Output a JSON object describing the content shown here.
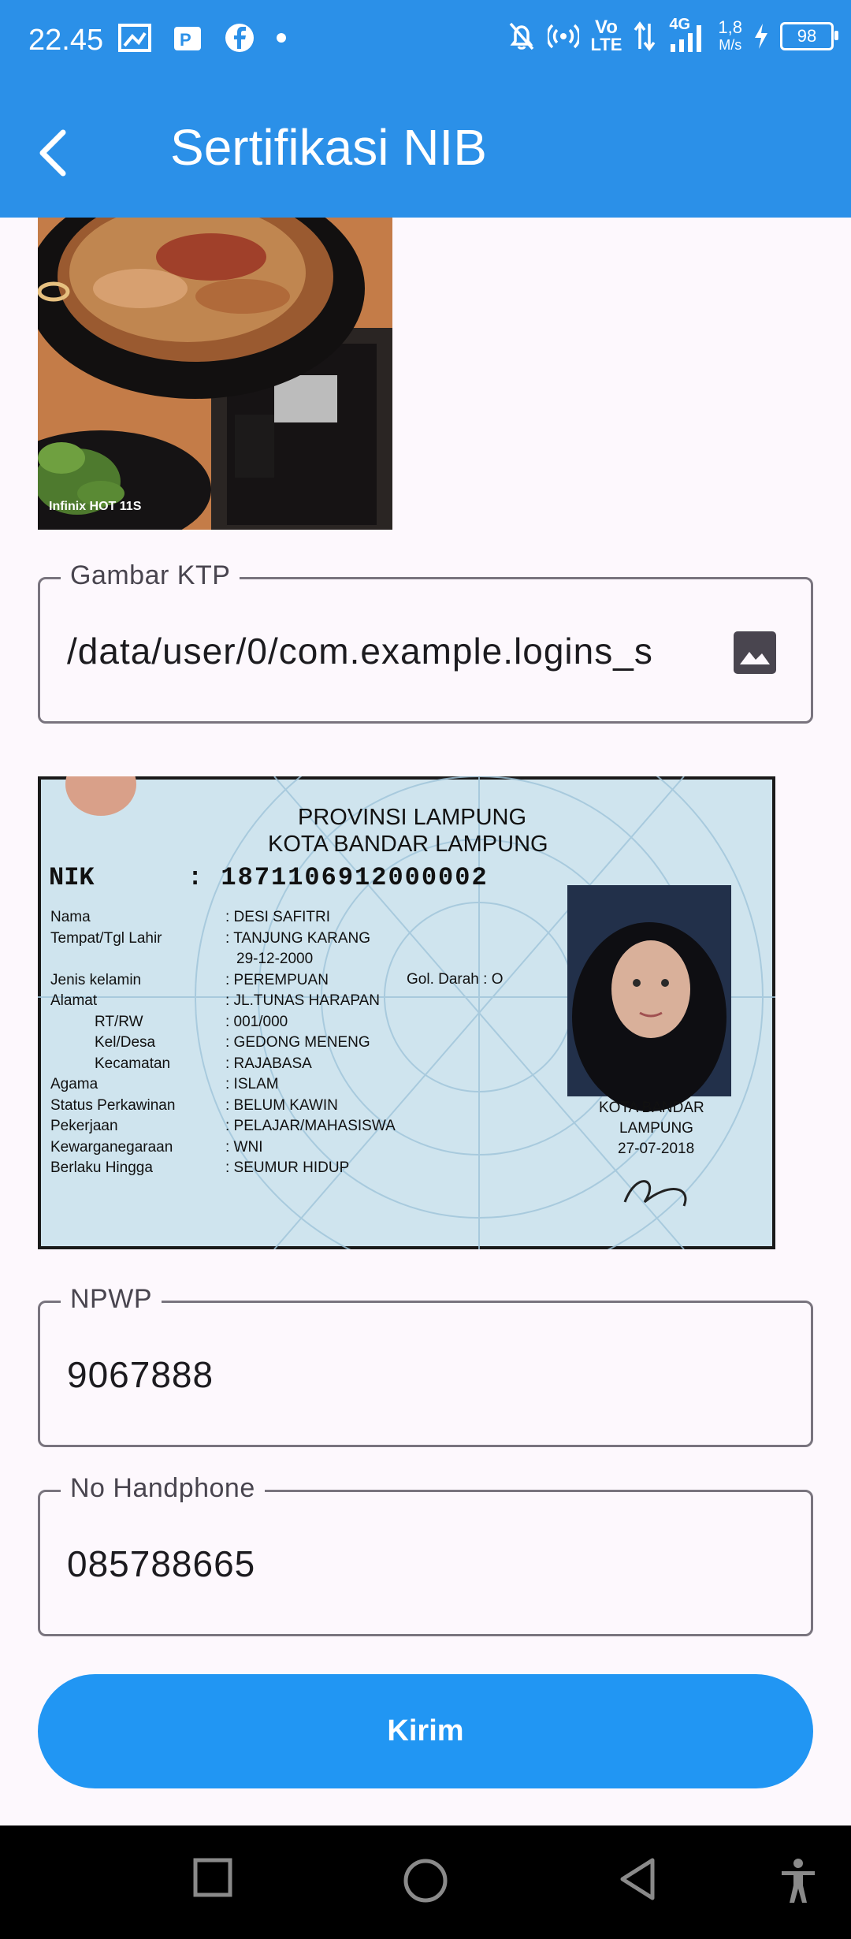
{
  "status_bar": {
    "time": "22.45",
    "data_speed_value": "1,8",
    "data_speed_unit": "M/s",
    "network_label": "4G",
    "volte_label_1": "Vo",
    "volte_label_2": "LTE",
    "battery": "98"
  },
  "app_bar": {
    "title": "Sertifikasi NIB"
  },
  "food_photo": {
    "watermark": "Infinix HOT 11S"
  },
  "ktp_field": {
    "label": "Gambar KTP",
    "value": "/data/user/0/com.example.logins_s"
  },
  "ktp_card": {
    "province": "PROVINSI LAMPUNG",
    "city": "KOTA BANDAR LAMPUNG",
    "nik_label": "NIK",
    "nik": ": 1871106912000002",
    "rows": [
      {
        "k": "Nama",
        "v": ": DESI SAFITRI"
      },
      {
        "k": "Tempat/Tgl Lahir",
        "v": ": TANJUNG KARANG"
      },
      {
        "k": "",
        "v": "29-12-2000"
      },
      {
        "k": "Jenis kelamin",
        "v": ": PEREMPUAN"
      },
      {
        "k": "Alamat",
        "v": ": JL.TUNAS HARAPAN"
      },
      {
        "k": "RT/RW",
        "v": ": 001/000"
      },
      {
        "k": "Kel/Desa",
        "v": ": GEDONG MENENG"
      },
      {
        "k": "Kecamatan",
        "v": ": RAJABASA"
      },
      {
        "k": "Agama",
        "v": ": ISLAM"
      },
      {
        "k": "Status Perkawinan",
        "v": ": BELUM KAWIN"
      },
      {
        "k": "Pekerjaan",
        "v": ": PELAJAR/MAHASISWA"
      },
      {
        "k": "Kewarganegaraan",
        "v": ": WNI"
      },
      {
        "k": "Berlaku Hingga",
        "v": ": SEUMUR HIDUP"
      }
    ],
    "blood_type": "Gol. Darah  : O",
    "issue_city": "KOTA BANDAR",
    "issue_city_2": "LAMPUNG",
    "issue_date": "27-07-2018"
  },
  "npwp_field": {
    "label": "NPWP",
    "value": "9067888"
  },
  "phone_field": {
    "label": "No Handphone",
    "value": "085788665"
  },
  "submit": {
    "label": "Kirim"
  },
  "colors": {
    "primary": "#2b90e8",
    "button": "#2196f3",
    "background": "#fdf8fd"
  }
}
